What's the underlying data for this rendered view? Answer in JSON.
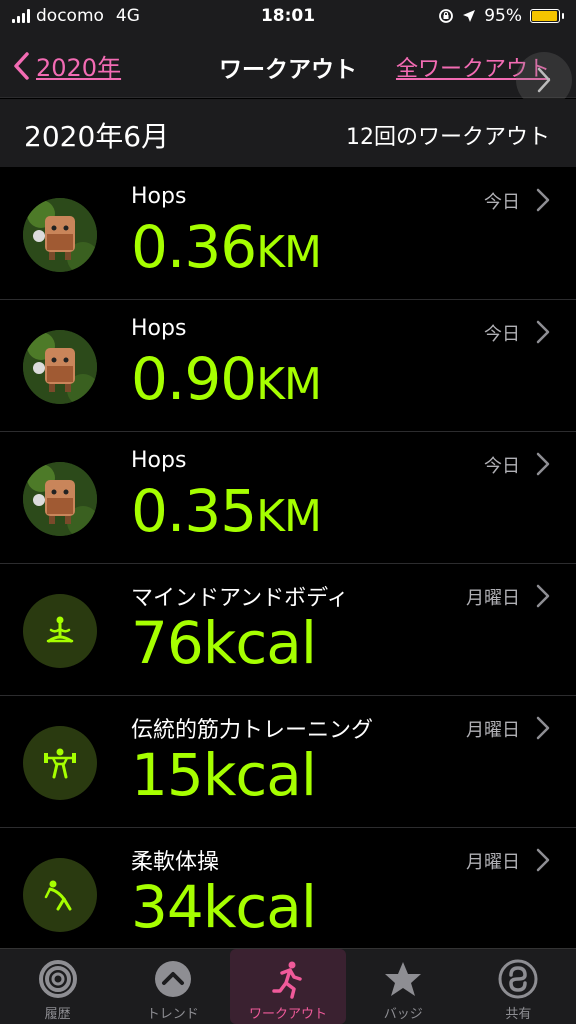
{
  "status_bar": {
    "carrier": "docomo",
    "network": "4G",
    "time": "18:01",
    "battery": "95%",
    "battery_level": 0.95
  },
  "nav": {
    "back_label": "2020年",
    "title": "ワークアウト",
    "all_label": "全ワークアウト"
  },
  "section": {
    "month": "2020年6月",
    "count": "12回のワークアウト"
  },
  "workouts": [
    {
      "name": "Hops",
      "value": "0.36",
      "unit": "KM",
      "date": "今日",
      "icon": "hops-avatar"
    },
    {
      "name": "Hops",
      "value": "0.90",
      "unit": "KM",
      "date": "今日",
      "icon": "hops-avatar"
    },
    {
      "name": "Hops",
      "value": "0.35",
      "unit": "KM",
      "date": "今日",
      "icon": "hops-avatar"
    },
    {
      "name": "マインドアンドボディ",
      "value": "76",
      "unit": "kcal",
      "date": "月曜日",
      "icon": "mind-body-icon"
    },
    {
      "name": "伝統的筋力トレーニング",
      "value": "15",
      "unit": "kcal",
      "date": "月曜日",
      "icon": "strength-training-icon"
    },
    {
      "name": "柔軟体操",
      "value": "34",
      "unit": "kcal",
      "date": "月曜日",
      "icon": "flexibility-icon"
    }
  ],
  "tabs": [
    {
      "label": "履歴",
      "icon": "history-ring-icon"
    },
    {
      "label": "トレンド",
      "icon": "trends-icon"
    },
    {
      "label": "ワークアウト",
      "icon": "workout-runner-icon",
      "active": true
    },
    {
      "label": "バッジ",
      "icon": "badge-star-icon"
    },
    {
      "label": "共有",
      "icon": "sharing-icon"
    }
  ],
  "colors": {
    "accent": "#f26bb3",
    "metric": "#a6ff00",
    "active_tab": "#f05a9a"
  }
}
